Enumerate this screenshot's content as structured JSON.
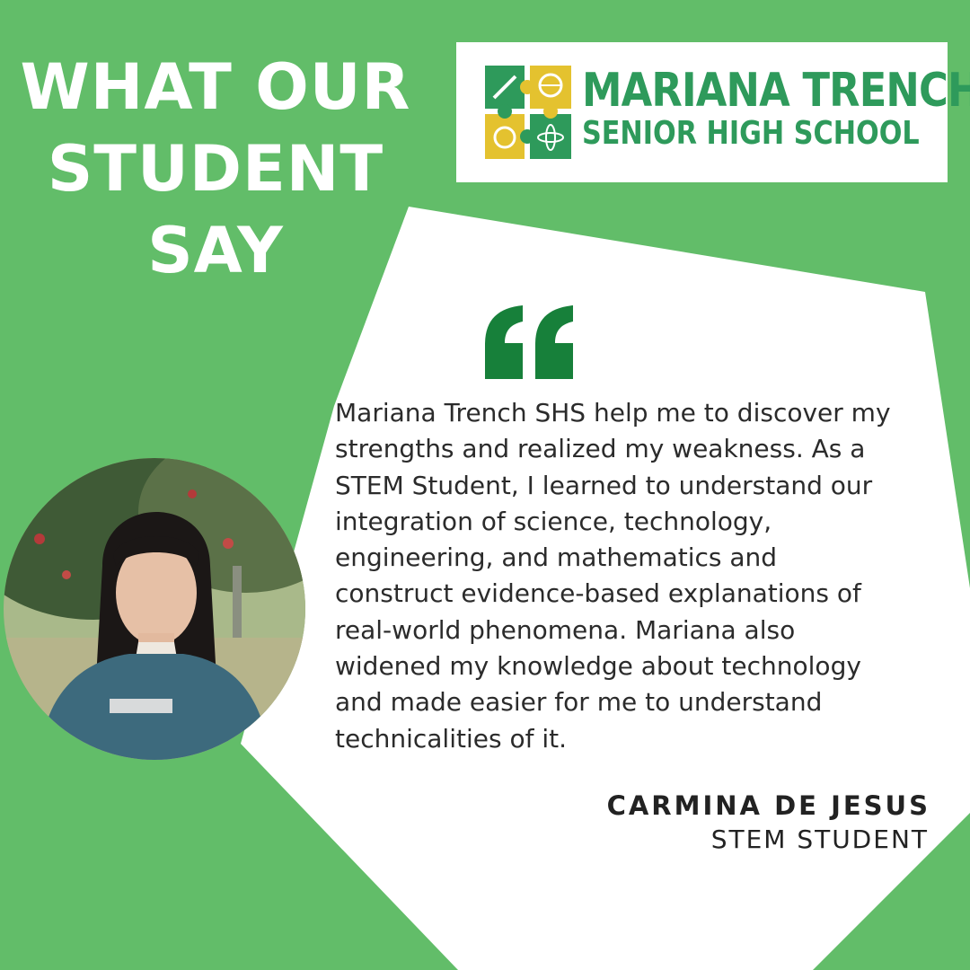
{
  "headline": [
    "WHAT OUR",
    "STUDENT",
    "SAY"
  ],
  "logo": {
    "line1": "MARIANA TRENCH",
    "line2": "SENIOR HIGH SCHOOL",
    "color": "#2e9a5b",
    "puzzle_colors": [
      "#2e9a5b",
      "#e4c22f"
    ]
  },
  "quote": {
    "icon": "quote-icon",
    "text": "Mariana Trench SHS help me to discover my\nstrengths and realized my weakness. As a\nSTEM Student, I learned to understand our\nintegration of science, technology,\nengineering, and mathematics and\nconstruct evidence-based explanations of\nreal-world phenomena. Mariana also\nwidened my knowledge about technology\nand made easier for me to understand\ntechnicalities of it."
  },
  "author": {
    "name": "CARMINA DE JESUS",
    "role": "STEM STUDENT"
  },
  "colors": {
    "background": "#62bd69",
    "card": "#ffffff",
    "quote_mark": "#17803a",
    "text": "#2b2b2b"
  }
}
